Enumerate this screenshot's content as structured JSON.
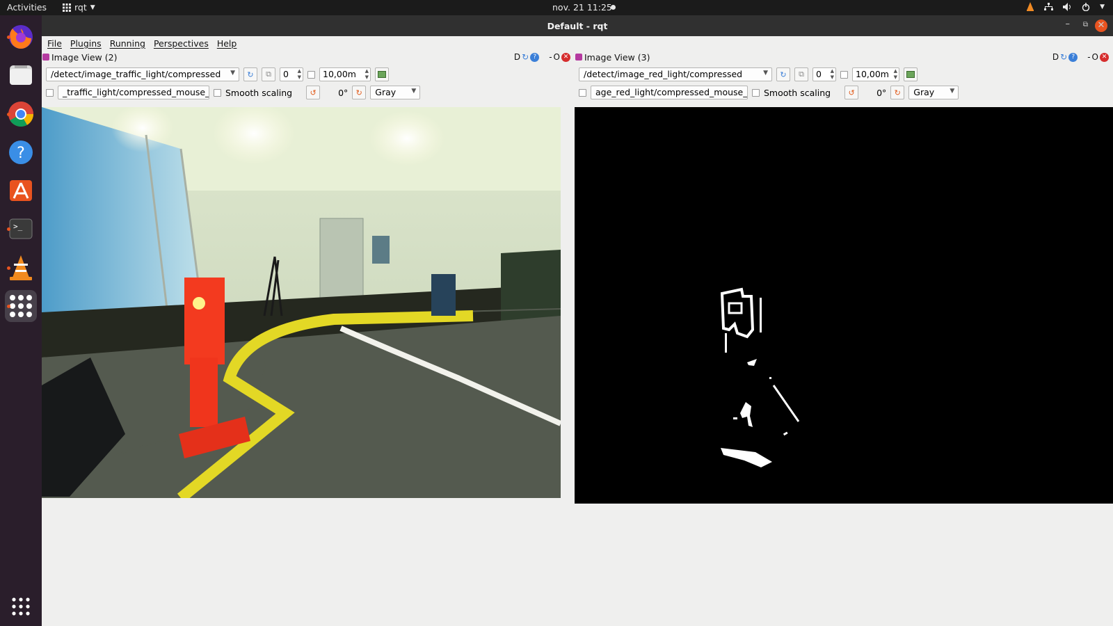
{
  "topbar": {
    "activities": "Activities",
    "app_name": "rqt",
    "clock": "nov. 21  11:25"
  },
  "dock": {
    "items": [
      {
        "name": "Firefox",
        "icon": "firefox-icon"
      },
      {
        "name": "Files",
        "icon": "files-icon"
      },
      {
        "name": "Chrome",
        "icon": "chrome-icon"
      },
      {
        "name": "Help",
        "icon": "help-icon"
      },
      {
        "name": "Ubuntu Software",
        "icon": "software-icon"
      },
      {
        "name": "Terminal",
        "icon": "terminal-icon"
      },
      {
        "name": "VLC",
        "icon": "vlc-icon"
      },
      {
        "name": "rqt",
        "icon": "rqt-app-icon"
      },
      {
        "name": "Show Applications",
        "icon": "app-grid-icon"
      }
    ]
  },
  "window": {
    "title": "Default - rqt"
  },
  "menu": [
    "File",
    "Plugins",
    "Running",
    "Perspectives",
    "Help"
  ],
  "panels": {
    "left": {
      "title": "Image View (2)",
      "topic": "/detect/image_traffic_light/compressed",
      "spin_value": "0",
      "max_value": "10,00m",
      "mouse_topic": "_traffic_light/compressed_mouse_left",
      "smooth_label": "Smooth scaling",
      "rotation": "0°",
      "color_mode": "Gray",
      "ctrl": "D",
      "dash": "-",
      "o": "O"
    },
    "right": {
      "title": "Image View (3)",
      "topic": "/detect/image_red_light/compressed",
      "spin_value": "0",
      "max_value": "10,00m",
      "mouse_topic": "age_red_light/compressed_mouse_left",
      "smooth_label": "Smooth scaling",
      "rotation": "0°",
      "color_mode": "Gray",
      "ctrl": "D",
      "dash": "-",
      "o": "O"
    }
  }
}
